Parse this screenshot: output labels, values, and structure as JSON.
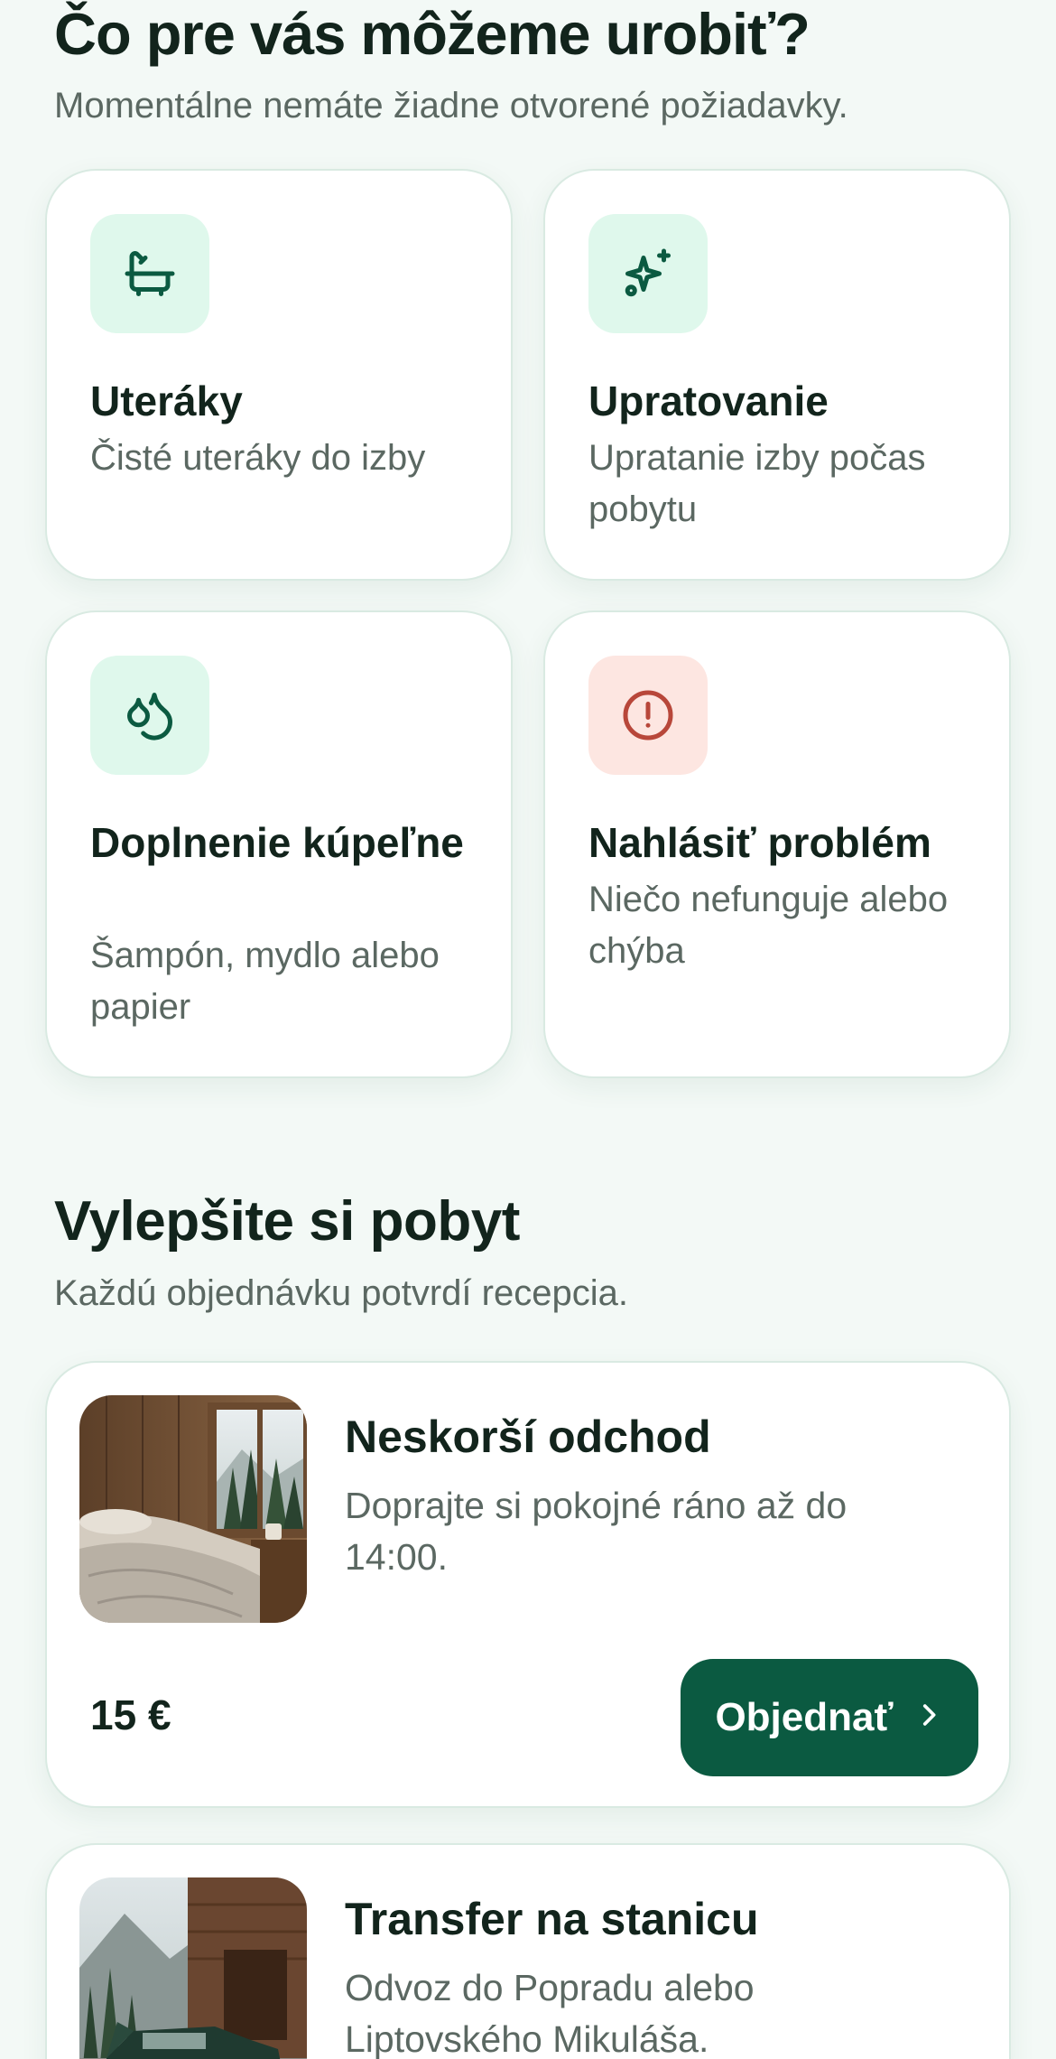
{
  "services": {
    "heading": "Čo pre vás môžeme urobiť?",
    "subheading": "Momentálne nemáte žiadne otvorené požiadavky.",
    "cards": [
      {
        "title": "Uteráky",
        "desc": "Čisté uteráky do izby",
        "icon": "bathtub-icon"
      },
      {
        "title": "Upratovanie",
        "desc": "Upratanie izby počas pobytu",
        "icon": "sparkles-icon"
      },
      {
        "title": "Doplnenie kúpeľne",
        "desc": "Šampón, mydlo alebo papier",
        "icon": "droplets-icon"
      },
      {
        "title": "Nahlásiť problém",
        "desc": "Niečo nefunguje alebo chýba",
        "icon": "alert-circle-icon"
      }
    ]
  },
  "upgrades": {
    "heading": "Vylepšite si pobyt",
    "subheading": "Každú objednávku potvrdí recepcia.",
    "items": [
      {
        "title": "Neskorší odchod",
        "desc": "Doprajte si pokojné ráno až do 14:00.",
        "price": "15 €",
        "button": "Objednať"
      },
      {
        "title": "Transfer na stanicu",
        "desc": "Odvoz do Popradu alebo Liptovského Mikuláša."
      }
    ]
  },
  "colors": {
    "accent": "#0b5a41",
    "icon_bg": "#dff8ec",
    "alert_bg": "#fde6e1",
    "alert": "#b8473a",
    "background": "#f3f9f6"
  }
}
